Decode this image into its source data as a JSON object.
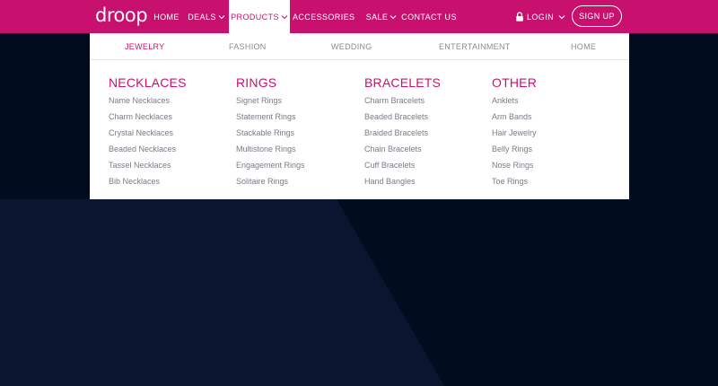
{
  "brand": {
    "logo_text": "droop"
  },
  "colors": {
    "accent": "#c8116f",
    "background": "#0b1530",
    "link": "#7b7b85"
  },
  "nav": {
    "items": [
      {
        "label": "HOME"
      },
      {
        "label": "DEALS"
      },
      {
        "label": "PRODUCTS"
      },
      {
        "label": "ACCESSORIES"
      },
      {
        "label": "SALE"
      },
      {
        "label": "CONTACT US"
      }
    ],
    "active": "PRODUCTS",
    "login_label": "LOGIN",
    "signup_label": "SIGN UP"
  },
  "mega_menu": {
    "tabs": [
      "JEWELRY",
      "FASHION",
      "WEDDING",
      "ENTERTAINMENT",
      "HOME"
    ],
    "active_tab": "JEWELRY",
    "columns": [
      {
        "title": "NECKLACES",
        "links": [
          "Name Necklaces",
          "Charm Necklaces",
          "Crystal Necklaces",
          "Beaded Necklaces",
          "Tassel Necklaces",
          "Bib Necklaces"
        ]
      },
      {
        "title": "RINGS",
        "links": [
          "Signet Rings",
          "Statement Rings",
          "Stackable Rings",
          "Multistone Rings",
          "Engagement Rings",
          "Solitaire Rings"
        ]
      },
      {
        "title": "BRACELETS",
        "links": [
          "Charm Bracelets",
          "Beaded Bracelets",
          "Braided Bracelets",
          "Chain Bracelets",
          "Cuff Bracelets",
          "Hand Bangles"
        ]
      },
      {
        "title": "OTHER",
        "links": [
          "Anklets",
          "Arm Bands",
          "Hair Jewelry",
          "Belly Rings",
          "Nose Rings",
          "Toe Rings"
        ]
      }
    ]
  }
}
